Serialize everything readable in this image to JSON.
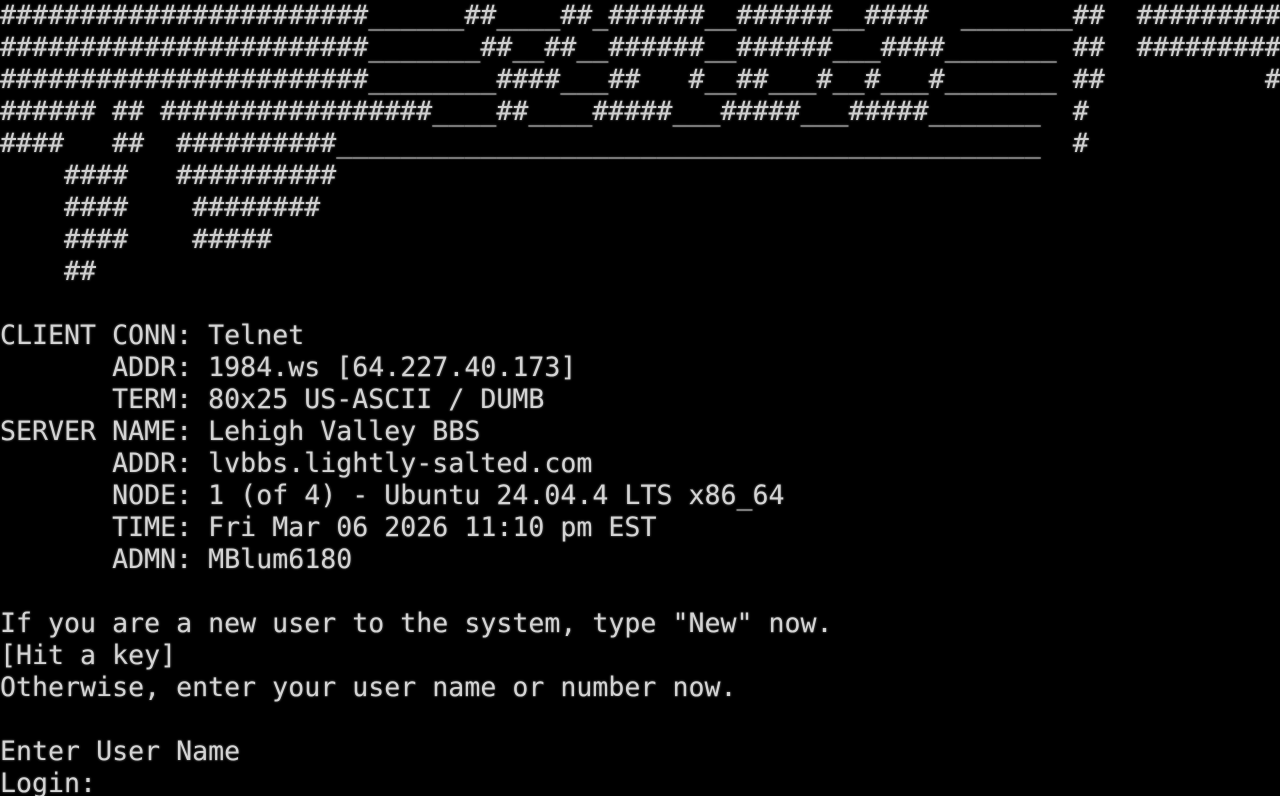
{
  "banner": [
    "#######################______##____##_######__######__####  _______##  #########",
    "#######################_______##__##__######__######___####_______ ##  #########",
    "#######################________####___##   #__##___#__#___#_______ ##          #",
    "###### ## #################____##____#####___#####___#####_______  #",
    "####   ##  ##########____________________________________________  #",
    "    ####   ##########",
    "    ####    ########",
    "    ####    #####",
    "    ##"
  ],
  "client": {
    "conn_label": "CLIENT CONN:",
    "conn_value": "Telnet",
    "addr_label": "ADDR:",
    "addr_value": "1984.ws [64.227.40.173]",
    "term_label": "TERM:",
    "term_value": "80x25 US-ASCII / DUMB"
  },
  "server": {
    "name_label": "SERVER NAME:",
    "name_value": "Lehigh Valley BBS",
    "addr_label": "ADDR:",
    "addr_value": "lvbbs.lightly-salted.com",
    "node_label": "NODE:",
    "node_value": "1 (of 4) - Ubuntu 24.04.4 LTS x86_64",
    "time_label": "TIME:",
    "time_value": "Fri Mar 06 2026 11:10 pm EST",
    "admin_label": "ADMN:",
    "admin_value": "MBlum6180"
  },
  "messages": {
    "new_user": "If you are a new user to the system, type \"New\" now.",
    "hit_key": "[Hit a key]",
    "otherwise": "Otherwise, enter your user name or number now."
  },
  "login": {
    "enter_label": "Enter User Name",
    "prompt_label": "Login:",
    "input_value": ""
  },
  "colors": {
    "background": "#000000",
    "text": "#d4d4d4"
  }
}
